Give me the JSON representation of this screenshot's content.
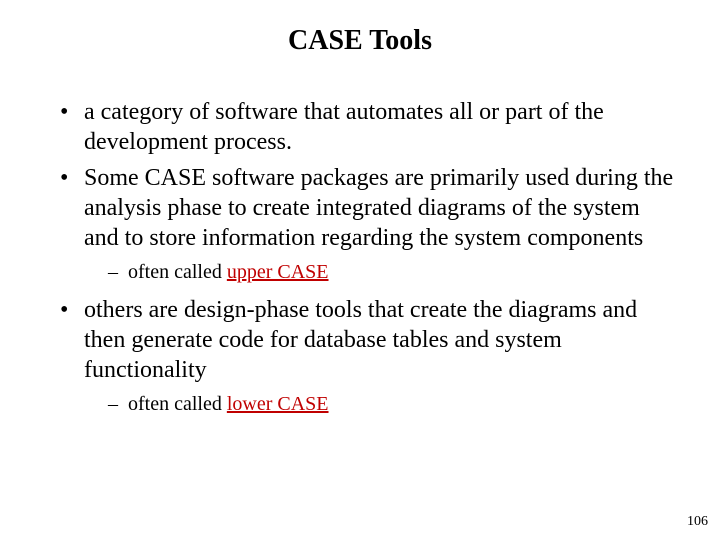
{
  "title": "CASE Tools",
  "bullets": [
    {
      "text": "a category of software that automates all or part of the development process.",
      "sub": null
    },
    {
      "text": "Some CASE software packages are primarily used during the analysis phase to create integrated diagrams of the system and to store information regarding the system components",
      "sub": {
        "prefix": "often called ",
        "highlight": "upper CASE"
      }
    },
    {
      "text": "others are design-phase tools that create the diagrams and then generate code for database tables and system functionality",
      "sub": {
        "prefix": "often called ",
        "highlight": "lower CASE"
      }
    }
  ],
  "page_number": "106"
}
